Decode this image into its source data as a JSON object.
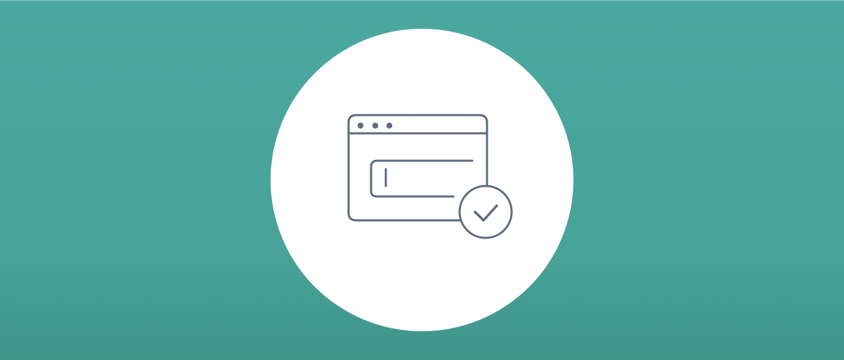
{
  "banner": {
    "background_color": "#48a398",
    "circle_color": "#ffffff",
    "icon_stroke_color": "#5f6b80",
    "icons": {
      "main": "browser-window-icon",
      "badge": "checkmark-circle-icon",
      "field": "text-input-icon"
    }
  }
}
